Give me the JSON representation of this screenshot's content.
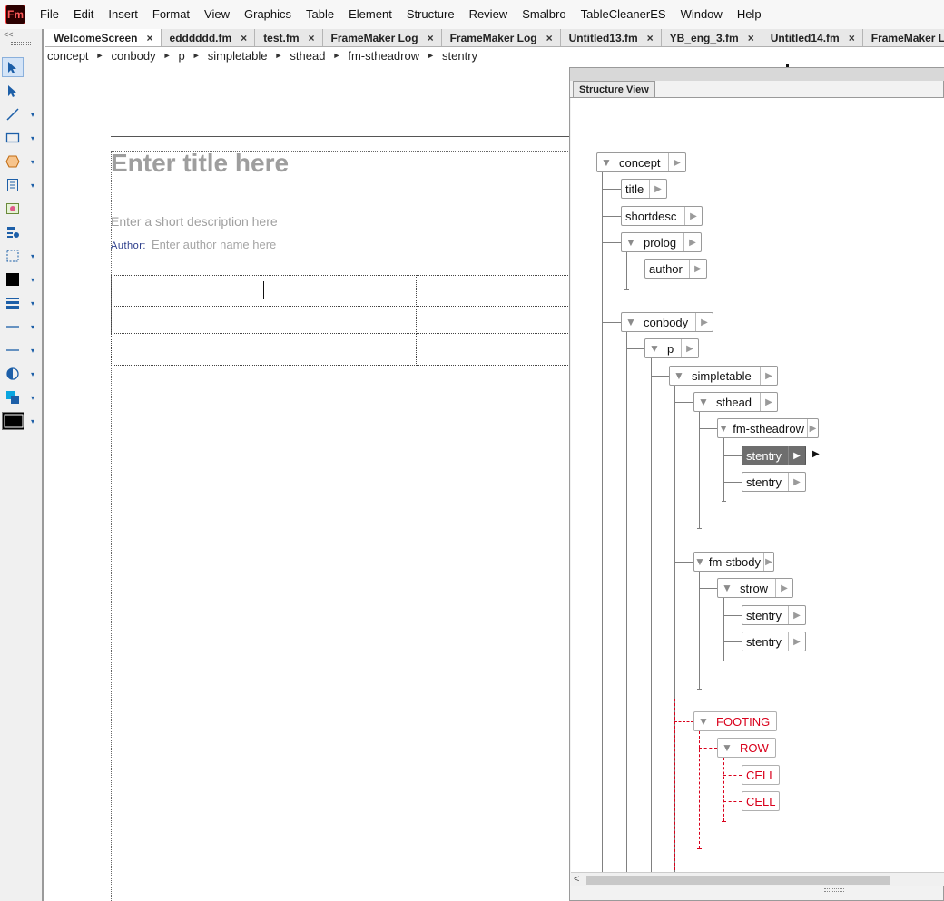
{
  "app": {
    "logo_text": "Fm",
    "menu": [
      "File",
      "Edit",
      "Insert",
      "Format",
      "View",
      "Graphics",
      "Table",
      "Element",
      "Structure",
      "Review",
      "Smalbro",
      "TableCleanerES",
      "Window",
      "Help"
    ]
  },
  "toolbar": {
    "collapse_glyph": "<<",
    "tools": [
      {
        "name": "smart-select-icon",
        "active": true,
        "dd": false
      },
      {
        "name": "object-select-icon",
        "active": false,
        "dd": false
      },
      {
        "name": "line-tool-icon",
        "active": false,
        "dd": true
      },
      {
        "name": "rectangle-tool-icon",
        "active": false,
        "dd": true
      },
      {
        "name": "polygon-tool-icon",
        "active": false,
        "dd": true
      },
      {
        "name": "text-frame-icon",
        "active": false,
        "dd": true
      },
      {
        "name": "graphic-frame-icon",
        "active": false,
        "dd": false
      },
      {
        "name": "format-painter-icon",
        "active": false,
        "dd": false
      },
      {
        "name": "selection-frame-icon",
        "active": false,
        "dd": true
      },
      {
        "name": "fill-color-icon",
        "active": false,
        "dd": true
      },
      {
        "name": "line-weight-icon",
        "active": false,
        "dd": true
      },
      {
        "name": "line-style-icon",
        "active": false,
        "dd": true
      },
      {
        "name": "line-end-icon",
        "active": false,
        "dd": true
      },
      {
        "name": "tint-icon",
        "active": false,
        "dd": true
      },
      {
        "name": "overprint-icon",
        "active": false,
        "dd": true
      },
      {
        "name": "color-swatch-icon",
        "active": false,
        "dd": true
      }
    ]
  },
  "tabs": [
    {
      "label": "WelcomeScreen"
    },
    {
      "label": "edddddd.fm"
    },
    {
      "label": "test.fm"
    },
    {
      "label": "FrameMaker Log"
    },
    {
      "label": "FrameMaker Log"
    },
    {
      "label": "Untitled13.fm"
    },
    {
      "label": "YB_eng_3.fm"
    },
    {
      "label": "Untitled14.fm"
    },
    {
      "label": "FrameMaker Log"
    }
  ],
  "tab_close_glyph": "×",
  "breadcrumb": [
    "concept",
    "conbody",
    "p",
    "simpletable",
    "sthead",
    "fm-stheadrow",
    "stentry"
  ],
  "breadcrumb_sep": "►",
  "document": {
    "title": "Enter title here",
    "shortdesc": "Enter a short description here",
    "author_label": "Author:",
    "author_placeholder": "Enter author name here"
  },
  "structure_view": {
    "tab_label": "Structure View",
    "nodes": [
      {
        "label": "concept",
        "expander": true,
        "state": "normal"
      },
      {
        "label": "title",
        "expander": false,
        "state": "normal"
      },
      {
        "label": "shortdesc",
        "expander": false,
        "state": "normal"
      },
      {
        "label": "prolog",
        "expander": true,
        "state": "normal"
      },
      {
        "label": "author",
        "expander": false,
        "state": "normal"
      },
      {
        "label": "conbody",
        "expander": true,
        "state": "normal"
      },
      {
        "label": "p",
        "expander": true,
        "state": "normal"
      },
      {
        "label": "simpletable",
        "expander": true,
        "state": "normal"
      },
      {
        "label": "sthead",
        "expander": true,
        "state": "normal"
      },
      {
        "label": "fm-stheadrow",
        "expander": true,
        "state": "normal"
      },
      {
        "label": "stentry",
        "expander": false,
        "state": "selected"
      },
      {
        "label": "stentry",
        "expander": false,
        "state": "normal"
      },
      {
        "label": "fm-stbody",
        "expander": true,
        "state": "normal"
      },
      {
        "label": "strow",
        "expander": true,
        "state": "normal"
      },
      {
        "label": "stentry",
        "expander": false,
        "state": "normal"
      },
      {
        "label": "stentry",
        "expander": false,
        "state": "normal"
      },
      {
        "label": "FOOTING",
        "expander": true,
        "state": "invalid"
      },
      {
        "label": "ROW",
        "expander": true,
        "state": "invalid"
      },
      {
        "label": "CELL",
        "expander": false,
        "state": "invalid"
      },
      {
        "label": "CELL",
        "expander": false,
        "state": "invalid"
      }
    ],
    "collapse_glyph": "▼",
    "expand_glyph": "▶"
  },
  "colors": {
    "invalid_element": "#d9001b",
    "selected_node": "#6e6e6e",
    "toolbar_accent": "#1d5fa8",
    "author_label": "#2a3c8a"
  }
}
